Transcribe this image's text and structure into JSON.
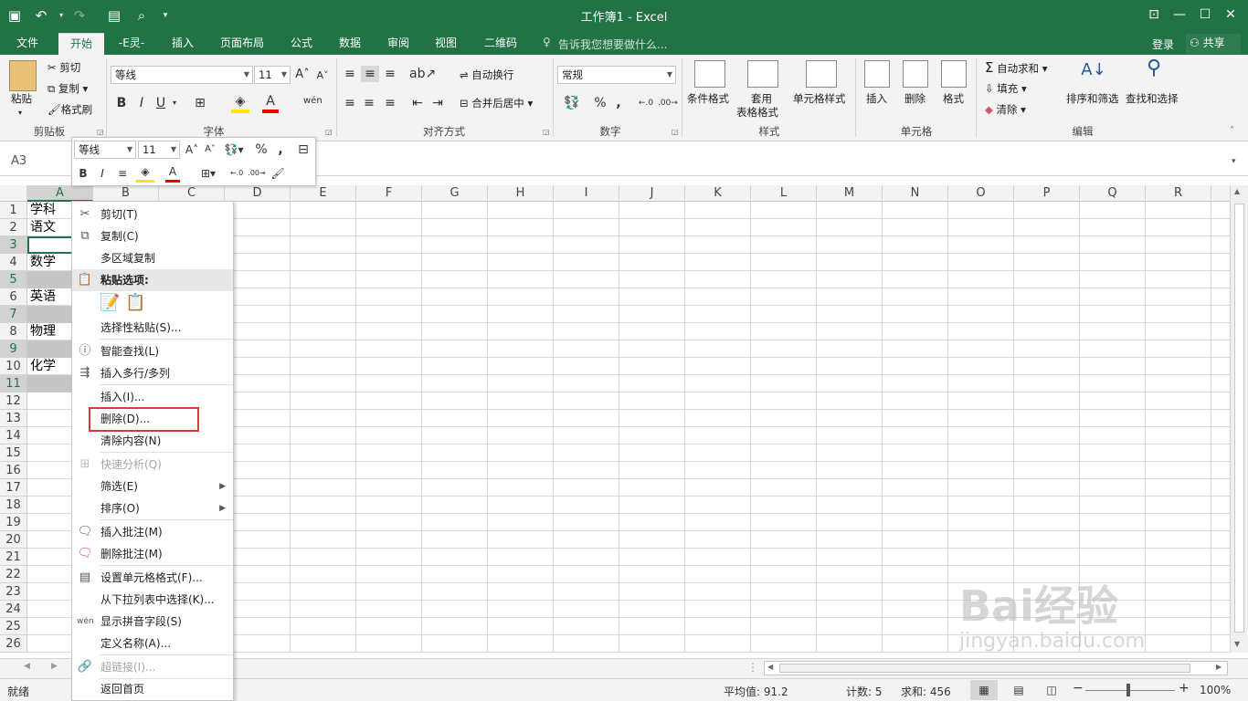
{
  "window": {
    "title": "工作簿1 - Excel"
  },
  "tabs": [
    "文件",
    "开始",
    "-E灵-",
    "插入",
    "页面布局",
    "公式",
    "数据",
    "审阅",
    "视图",
    "二维码"
  ],
  "tell_me": "告诉我您想要做什么...",
  "signin": "登录",
  "share": "共享",
  "ribbon": {
    "paste": "粘贴",
    "cut": "剪切",
    "copy": "复制",
    "format_painter": "格式刷",
    "clipboard": "剪贴板",
    "font_name": "等线",
    "font_size": "11",
    "font_group": "字体",
    "wrap_text": "自动换行",
    "merge_center": "合并后居中",
    "alignment_group": "对齐方式",
    "number_format": "常规",
    "number_group": "数字",
    "cond_format": "条件格式",
    "table_format_1": "套用",
    "table_format_2": "表格格式",
    "cell_styles": "单元格样式",
    "styles_group": "样式",
    "insert": "插入",
    "delete": "删除",
    "format": "格式",
    "cells_group": "单元格",
    "autosum": "自动求和",
    "fill": "填充",
    "clear": "清除",
    "sort_filter": "排序和筛选",
    "find_select": "查找和选择",
    "editing_group": "编辑"
  },
  "namebox": "A3",
  "columns": [
    "A",
    "B",
    "C",
    "D",
    "E",
    "F",
    "G",
    "H",
    "I",
    "J",
    "K",
    "L",
    "M",
    "N",
    "O",
    "P",
    "Q",
    "R"
  ],
  "rows": [
    "1",
    "2",
    "3",
    "4",
    "5",
    "6",
    "7",
    "8",
    "9",
    "10",
    "11",
    "12",
    "13",
    "14",
    "15",
    "16",
    "17",
    "18",
    "19",
    "20",
    "21",
    "22",
    "23",
    "24",
    "25",
    "26"
  ],
  "cells": {
    "A1": "学科",
    "A2": "语文",
    "A4": "数学",
    "A6": "英语",
    "A8": "物理",
    "A10": "化学"
  },
  "minitoolbar": {
    "font": "等线",
    "size": "11"
  },
  "context_menu": {
    "cut": "剪切(T)",
    "copy": "复制(C)",
    "multi_copy": "多区域复制",
    "paste_options": "粘贴选项:",
    "paste_special": "选择性粘贴(S)...",
    "smart_lookup": "智能查找(L)",
    "insert_rows": "插入多行/多列",
    "insert": "插入(I)...",
    "delete": "删除(D)...",
    "clear": "清除内容(N)",
    "quick_analysis": "快速分析(Q)",
    "filter": "筛选(E)",
    "sort": "排序(O)",
    "insert_comment": "插入批注(M)",
    "delete_comment": "删除批注(M)",
    "format_cells": "设置单元格格式(F)...",
    "pick_list": "从下拉列表中选择(K)...",
    "phonetic": "显示拼音字段(S)",
    "define_name": "定义名称(A)...",
    "hyperlink": "超链接(I)...",
    "home": "返回首页"
  },
  "status": {
    "ready": "就绪",
    "average": "平均值: 91.2",
    "count": "计数: 5",
    "sum": "求和: 456",
    "zoom": "100%"
  },
  "watermark": "Bai经验",
  "watermark_url": "jingyan.baidu.com",
  "colors": {
    "excel_green": "#217346",
    "highlight_red": "#d9393b"
  }
}
